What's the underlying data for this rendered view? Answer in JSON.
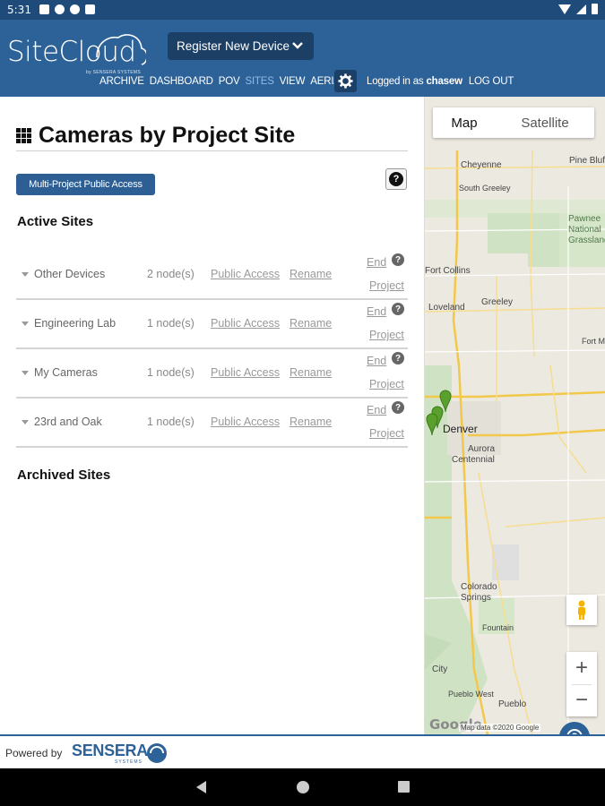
{
  "status_bar": {
    "time": "5:31",
    "icons": [
      "image-icon",
      "circle-icon",
      "app-icon",
      "sd-card-icon"
    ],
    "right_icons": [
      "wifi-icon",
      "signal-icon",
      "battery-icon"
    ]
  },
  "header": {
    "logo_text": "SiteCloud",
    "logo_subtext": "by SENSERA SYSTEMS",
    "register_button": "Register New Device",
    "nav": [
      {
        "label": "ARCHIVE",
        "active": false
      },
      {
        "label": "DASHBOARD",
        "active": false
      },
      {
        "label": "POV",
        "active": false
      },
      {
        "label": "SITES",
        "active": true
      },
      {
        "label": "VIEW",
        "active": false
      },
      {
        "label": "AERIAL",
        "active": false
      }
    ],
    "logged_in_prefix": "Logged in as",
    "username": "chasew",
    "logout": "LOG OUT",
    "colors": {
      "header_bg": "#2d6298",
      "button_bg": "#1c3f66",
      "active_nav": "#8fbbe8"
    }
  },
  "main": {
    "title": "Cameras by Project Site",
    "mppa_button": "Multi-Project Public Access",
    "help_label": "?",
    "active_heading": "Active Sites",
    "archived_heading": "Archived Sites",
    "sites": [
      {
        "name": "Other Devices",
        "nodes": "2 node(s)",
        "public_access": "Public Access",
        "rename": "Rename",
        "end": "End",
        "project": "Project"
      },
      {
        "name": "Engineering Lab",
        "nodes": "1 node(s)",
        "public_access": "Public Access",
        "rename": "Rename",
        "end": "End",
        "project": "Project"
      },
      {
        "name": "My Cameras",
        "nodes": "1 node(s)",
        "public_access": "Public Access",
        "rename": "Rename",
        "end": "End",
        "project": "Project"
      },
      {
        "name": "23rd and Oak",
        "nodes": "1 node(s)",
        "public_access": "Public Access",
        "rename": "Rename",
        "end": "End",
        "project": "Project"
      }
    ]
  },
  "map": {
    "type_options": [
      "Map",
      "Satellite"
    ],
    "selected_type": "Map",
    "zoom_in": "+",
    "zoom_out": "−",
    "google": "Google",
    "attribution": "Map data ©2020 Google",
    "cities": [
      "Cheyenne",
      "Pine Bluffs",
      "South Greeley",
      "Pawnee National Grassland",
      "Fort Collins",
      "Greeley",
      "Loveland",
      "Fort M",
      "Denver",
      "Aurora",
      "Centennial",
      "Colorado Springs",
      "Fountain",
      "Pueblo West",
      "Pueblo",
      "City"
    ]
  },
  "footer": {
    "powered_by": "Powered by",
    "brand": "SENSERA",
    "brand_sub": "SYSTEMS"
  }
}
